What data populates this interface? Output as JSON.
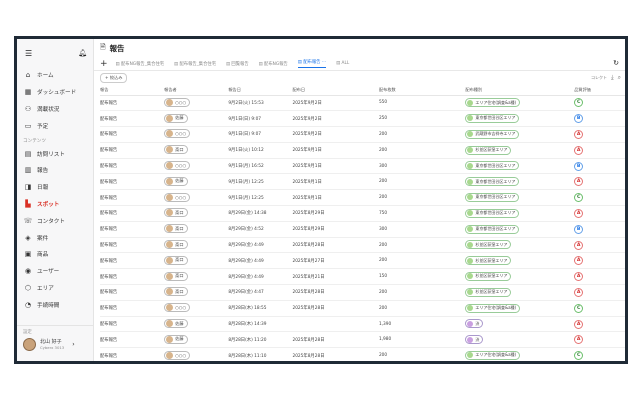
{
  "sidebar": {
    "menu_icon": "hamburger-icon",
    "bell_icon": "bell-icon",
    "items_top": [
      {
        "label": "ホーム",
        "icon": "⌂"
      },
      {
        "label": "ダッシュボード",
        "icon": "▦"
      },
      {
        "label": "満載状況",
        "icon": "⚇"
      },
      {
        "label": "予定",
        "icon": "▭"
      }
    ],
    "section_label": "コンテンツ",
    "items": [
      {
        "label": "訪問リスト",
        "icon": "▤",
        "active": false
      },
      {
        "label": "報告",
        "icon": "▥",
        "active": false
      },
      {
        "label": "日報",
        "icon": "◨",
        "active": false
      },
      {
        "label": "スポット",
        "icon": "▙",
        "active": true
      },
      {
        "label": "コンタクト",
        "icon": "☏",
        "active": false
      },
      {
        "label": "案件",
        "icon": "◈",
        "active": false
      },
      {
        "label": "商品",
        "icon": "▣",
        "active": false
      },
      {
        "label": "ユーザー",
        "icon": "◉",
        "active": false
      },
      {
        "label": "エリア",
        "icon": "⬡",
        "active": false
      },
      {
        "label": "手続時間",
        "icon": "◔",
        "active": false
      }
    ],
    "bottom_caption": "設定",
    "user_name": "北山 好子",
    "user_org": "Cyberx 3013"
  },
  "header": {
    "title": "報告",
    "tabs": [
      "配布NG報告_集合住宅",
      "配布報告_集合住宅",
      "回覧報告",
      "配布NG報告",
      "配布報告 ⋯",
      "ALL"
    ],
    "active_tab": 4,
    "add_filter": "+ 絞込み",
    "right_label": "コレクト"
  },
  "table": {
    "columns": [
      "報告",
      "報告者",
      "報告日",
      "配布日",
      "配布枚数",
      "配布種別",
      "品質評価"
    ],
    "rows": [
      {
        "type": "配布報告",
        "user": "○○○",
        "reported": "9月2日(火) 15:53",
        "date": "2025年9月2日",
        "count": "550",
        "area": "エリア住宅(調査&a種)",
        "area_style": "green",
        "grade": "C"
      },
      {
        "type": "配布報告",
        "user": "佐藤",
        "reported": "9月1日(日) 9:07",
        "date": "2025年9月2日",
        "count": "250",
        "area": "東京都世田谷区エリア",
        "area_style": "green",
        "grade": "B"
      },
      {
        "type": "配布報告",
        "user": "○○○",
        "reported": "9月1日(日) 9:07",
        "date": "2025年9月2日",
        "count": "200",
        "area": "武蔵野市吉祥寺エリア",
        "area_style": "green",
        "grade": "A"
      },
      {
        "type": "配布報告",
        "user": "斎口",
        "reported": "9月1日(火) 10:12",
        "date": "2025年9月1日",
        "count": "200",
        "area": "杉並区荻窪エリア",
        "area_style": "green",
        "grade": "A"
      },
      {
        "type": "配布報告",
        "user": "○○○",
        "reported": "9月1日(月) 16:52",
        "date": "2025年9月1日",
        "count": "300",
        "area": "東京都世田谷区エリア",
        "area_style": "green",
        "grade": "B"
      },
      {
        "type": "配布報告",
        "user": "佐藤",
        "reported": "9月1日(月) 12:25",
        "date": "2025年9月1日",
        "count": "200",
        "area": "東京都世田谷区エリア",
        "area_style": "green",
        "grade": "A"
      },
      {
        "type": "配布報告",
        "user": "○○○",
        "reported": "9月1日(月) 12:25",
        "date": "2025年9月1日",
        "count": "200",
        "area": "東京都世田谷区エリア",
        "area_style": "green",
        "grade": "C"
      },
      {
        "type": "配布報告",
        "user": "斎口",
        "reported": "8月29日(金) 14:38",
        "date": "2025年8月29日",
        "count": "750",
        "area": "東京都世田谷区エリア",
        "area_style": "green",
        "grade": "A"
      },
      {
        "type": "配布報告",
        "user": "斎口",
        "reported": "8月29日(金) 4:52",
        "date": "2025年8月29日",
        "count": "300",
        "area": "東京都世田谷区エリア",
        "area_style": "green",
        "grade": "B"
      },
      {
        "type": "配布報告",
        "user": "斎口",
        "reported": "8月29日(金) 4:49",
        "date": "2025年8月28日",
        "count": "200",
        "area": "杉並区荻窪エリア",
        "area_style": "green",
        "grade": "A"
      },
      {
        "type": "配布報告",
        "user": "斎口",
        "reported": "8月29日(金) 4:49",
        "date": "2025年8月27日",
        "count": "200",
        "area": "杉並区荻窪エリア",
        "area_style": "green",
        "grade": "A"
      },
      {
        "type": "配布報告",
        "user": "斎口",
        "reported": "8月29日(金) 4:49",
        "date": "2025年8月21日",
        "count": "150",
        "area": "杉並区荻窪エリア",
        "area_style": "green",
        "grade": "A"
      },
      {
        "type": "配布報告",
        "user": "斎口",
        "reported": "8月29日(金) 4:47",
        "date": "2025年8月28日",
        "count": "200",
        "area": "杉並区荻窪エリア",
        "area_style": "green",
        "grade": "A"
      },
      {
        "type": "配布報告",
        "user": "○○○",
        "reported": "8月28日(木) 18:55",
        "date": "2025年8月28日",
        "count": "200",
        "area": "エリア住宅(調査&a種)",
        "area_style": "green",
        "grade": "C"
      },
      {
        "type": "配布報告",
        "user": "佐藤",
        "reported": "8月28日(木) 14:39",
        "date": "",
        "count": "1,390",
        "area": "渋",
        "area_style": "purple",
        "grade": "A"
      },
      {
        "type": "配布報告",
        "user": "佐藤",
        "reported": "8月28日(木) 11:20",
        "date": "2025年8月28日",
        "count": "1,980",
        "area": "渋",
        "area_style": "purple",
        "grade": "A"
      },
      {
        "type": "配布報告",
        "user": "○○○",
        "reported": "8月28日(木) 11:10",
        "date": "2025年8月28日",
        "count": "200",
        "area": "エリア住宅(調査&a種)",
        "area_style": "green",
        "grade": "C"
      }
    ]
  }
}
